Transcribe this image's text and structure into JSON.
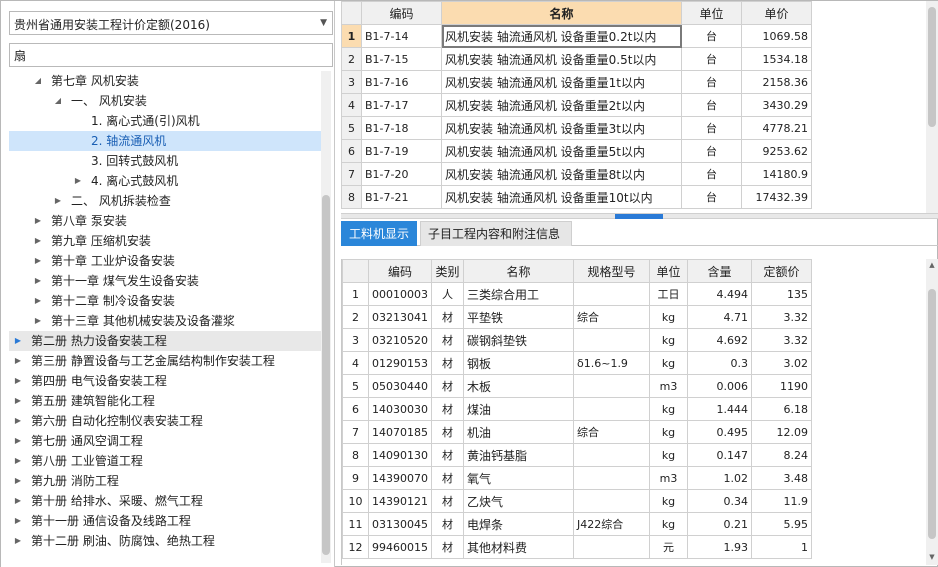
{
  "left": {
    "dropdown_value": "贵州省通用安装工程计价定额(2016)",
    "search_value": "扇",
    "tree": [
      {
        "label": "第七章 风机安装",
        "level": 2,
        "state": "expanded"
      },
      {
        "label": "一、 风机安装",
        "level": 3,
        "state": "expanded"
      },
      {
        "label": "1. 离心式通(引)风机",
        "level": 4,
        "state": "leaf"
      },
      {
        "label": "2. 轴流通风机",
        "level": 4,
        "state": "leaf",
        "selected": true
      },
      {
        "label": "3. 回转式鼓风机",
        "level": 4,
        "state": "leaf"
      },
      {
        "label": "4. 离心式鼓风机",
        "level": 4,
        "state": "collapsed"
      },
      {
        "label": "二、 风机拆装检查",
        "level": 3,
        "state": "collapsed"
      },
      {
        "label": "第八章 泵安装",
        "level": 2,
        "state": "collapsed"
      },
      {
        "label": "第九章 压缩机安装",
        "level": 2,
        "state": "collapsed"
      },
      {
        "label": "第十章 工业炉设备安装",
        "level": 2,
        "state": "collapsed"
      },
      {
        "label": "第十一章 煤气发生设备安装",
        "level": 2,
        "state": "collapsed"
      },
      {
        "label": "第十二章 制冷设备安装",
        "level": 2,
        "state": "collapsed"
      },
      {
        "label": "第十三章 其他机械安装及设备灌浆",
        "level": 2,
        "state": "collapsed"
      },
      {
        "label": "第二册 热力设备安装工程",
        "level": 1,
        "state": "collapsed",
        "highlighted": true
      },
      {
        "label": "第三册 静置设备与工艺金属结构制作安装工程",
        "level": 1,
        "state": "collapsed"
      },
      {
        "label": "第四册 电气设备安装工程",
        "level": 1,
        "state": "collapsed"
      },
      {
        "label": "第五册 建筑智能化工程",
        "level": 1,
        "state": "collapsed"
      },
      {
        "label": "第六册 自动化控制仪表安装工程",
        "level": 1,
        "state": "collapsed"
      },
      {
        "label": "第七册 通风空调工程",
        "level": 1,
        "state": "collapsed"
      },
      {
        "label": "第八册 工业管道工程",
        "level": 1,
        "state": "collapsed"
      },
      {
        "label": "第九册 消防工程",
        "level": 1,
        "state": "collapsed"
      },
      {
        "label": "第十册 给排水、采暖、燃气工程",
        "level": 1,
        "state": "collapsed"
      },
      {
        "label": "第十一册 通信设备及线路工程",
        "level": 1,
        "state": "collapsed"
      },
      {
        "label": "第十二册 刷油、防腐蚀、绝热工程",
        "level": 1,
        "state": "collapsed"
      }
    ]
  },
  "quota_table": {
    "headers": {
      "code": "编码",
      "name": "名称",
      "unit": "单位",
      "price": "单价"
    },
    "rows": [
      {
        "no": "1",
        "code": "B1-7-14",
        "name": "风机安装 轴流通风机 设备重量0.2t以内",
        "unit": "台",
        "price": "1069.58",
        "current": true
      },
      {
        "no": "2",
        "code": "B1-7-15",
        "name": "风机安装 轴流通风机 设备重量0.5t以内",
        "unit": "台",
        "price": "1534.18"
      },
      {
        "no": "3",
        "code": "B1-7-16",
        "name": "风机安装 轴流通风机 设备重量1t以内",
        "unit": "台",
        "price": "2158.36"
      },
      {
        "no": "4",
        "code": "B1-7-17",
        "name": "风机安装 轴流通风机 设备重量2t以内",
        "unit": "台",
        "price": "3430.29"
      },
      {
        "no": "5",
        "code": "B1-7-18",
        "name": "风机安装 轴流通风机 设备重量3t以内",
        "unit": "台",
        "price": "4778.21"
      },
      {
        "no": "6",
        "code": "B1-7-19",
        "name": "风机安装 轴流通风机 设备重量5t以内",
        "unit": "台",
        "price": "9253.62"
      },
      {
        "no": "7",
        "code": "B1-7-20",
        "name": "风机安装 轴流通风机 设备重量8t以内",
        "unit": "台",
        "price": "14180.9"
      },
      {
        "no": "8",
        "code": "B1-7-21",
        "name": "风机安装 轴流通风机 设备重量10t以内",
        "unit": "台",
        "price": "17432.39"
      }
    ]
  },
  "tabs": [
    {
      "label": "工料机显示",
      "active": true
    },
    {
      "label": "子目工程内容和附注信息",
      "active": false
    }
  ],
  "material_table": {
    "headers": {
      "code": "编码",
      "category": "类别",
      "name": "名称",
      "spec": "规格型号",
      "unit": "单位",
      "qty": "含量",
      "price": "定额价"
    },
    "rows": [
      {
        "no": "1",
        "code": "00010003",
        "category": "人",
        "name": "三类综合用工",
        "spec": "",
        "unit": "工日",
        "qty": "4.494",
        "price": "135"
      },
      {
        "no": "2",
        "code": "03213041",
        "category": "材",
        "name": "平垫铁",
        "spec": "综合",
        "unit": "kg",
        "qty": "4.71",
        "price": "3.32"
      },
      {
        "no": "3",
        "code": "03210520",
        "category": "材",
        "name": "碳钢斜垫铁",
        "spec": "",
        "unit": "kg",
        "qty": "4.692",
        "price": "3.32"
      },
      {
        "no": "4",
        "code": "01290153",
        "category": "材",
        "name": "钢板",
        "spec": "δ1.6~1.9",
        "unit": "kg",
        "qty": "0.3",
        "price": "3.02"
      },
      {
        "no": "5",
        "code": "05030440",
        "category": "材",
        "name": "木板",
        "spec": "",
        "unit": "m3",
        "qty": "0.006",
        "price": "1190"
      },
      {
        "no": "6",
        "code": "14030030",
        "category": "材",
        "name": "煤油",
        "spec": "",
        "unit": "kg",
        "qty": "1.444",
        "price": "6.18"
      },
      {
        "no": "7",
        "code": "14070185",
        "category": "材",
        "name": "机油",
        "spec": "综合",
        "unit": "kg",
        "qty": "0.495",
        "price": "12.09"
      },
      {
        "no": "8",
        "code": "14090130",
        "category": "材",
        "name": "黄油钙基脂",
        "spec": "",
        "unit": "kg",
        "qty": "0.147",
        "price": "8.24"
      },
      {
        "no": "9",
        "code": "14390070",
        "category": "材",
        "name": "氧气",
        "spec": "",
        "unit": "m3",
        "qty": "1.02",
        "price": "3.48"
      },
      {
        "no": "10",
        "code": "14390121",
        "category": "材",
        "name": "乙炔气",
        "spec": "",
        "unit": "kg",
        "qty": "0.34",
        "price": "11.9"
      },
      {
        "no": "11",
        "code": "03130045",
        "category": "材",
        "name": "电焊条",
        "spec": "J422综合",
        "unit": "kg",
        "qty": "0.21",
        "price": "5.95"
      },
      {
        "no": "12",
        "code": "99460015",
        "category": "材",
        "name": "其他材料费",
        "spec": "",
        "unit": "元",
        "qty": "1.93",
        "price": "1"
      }
    ]
  },
  "colors": {
    "accent": "#2a86d9",
    "header_highlight": "#fbdcb0",
    "selection": "#cfe5fb"
  }
}
